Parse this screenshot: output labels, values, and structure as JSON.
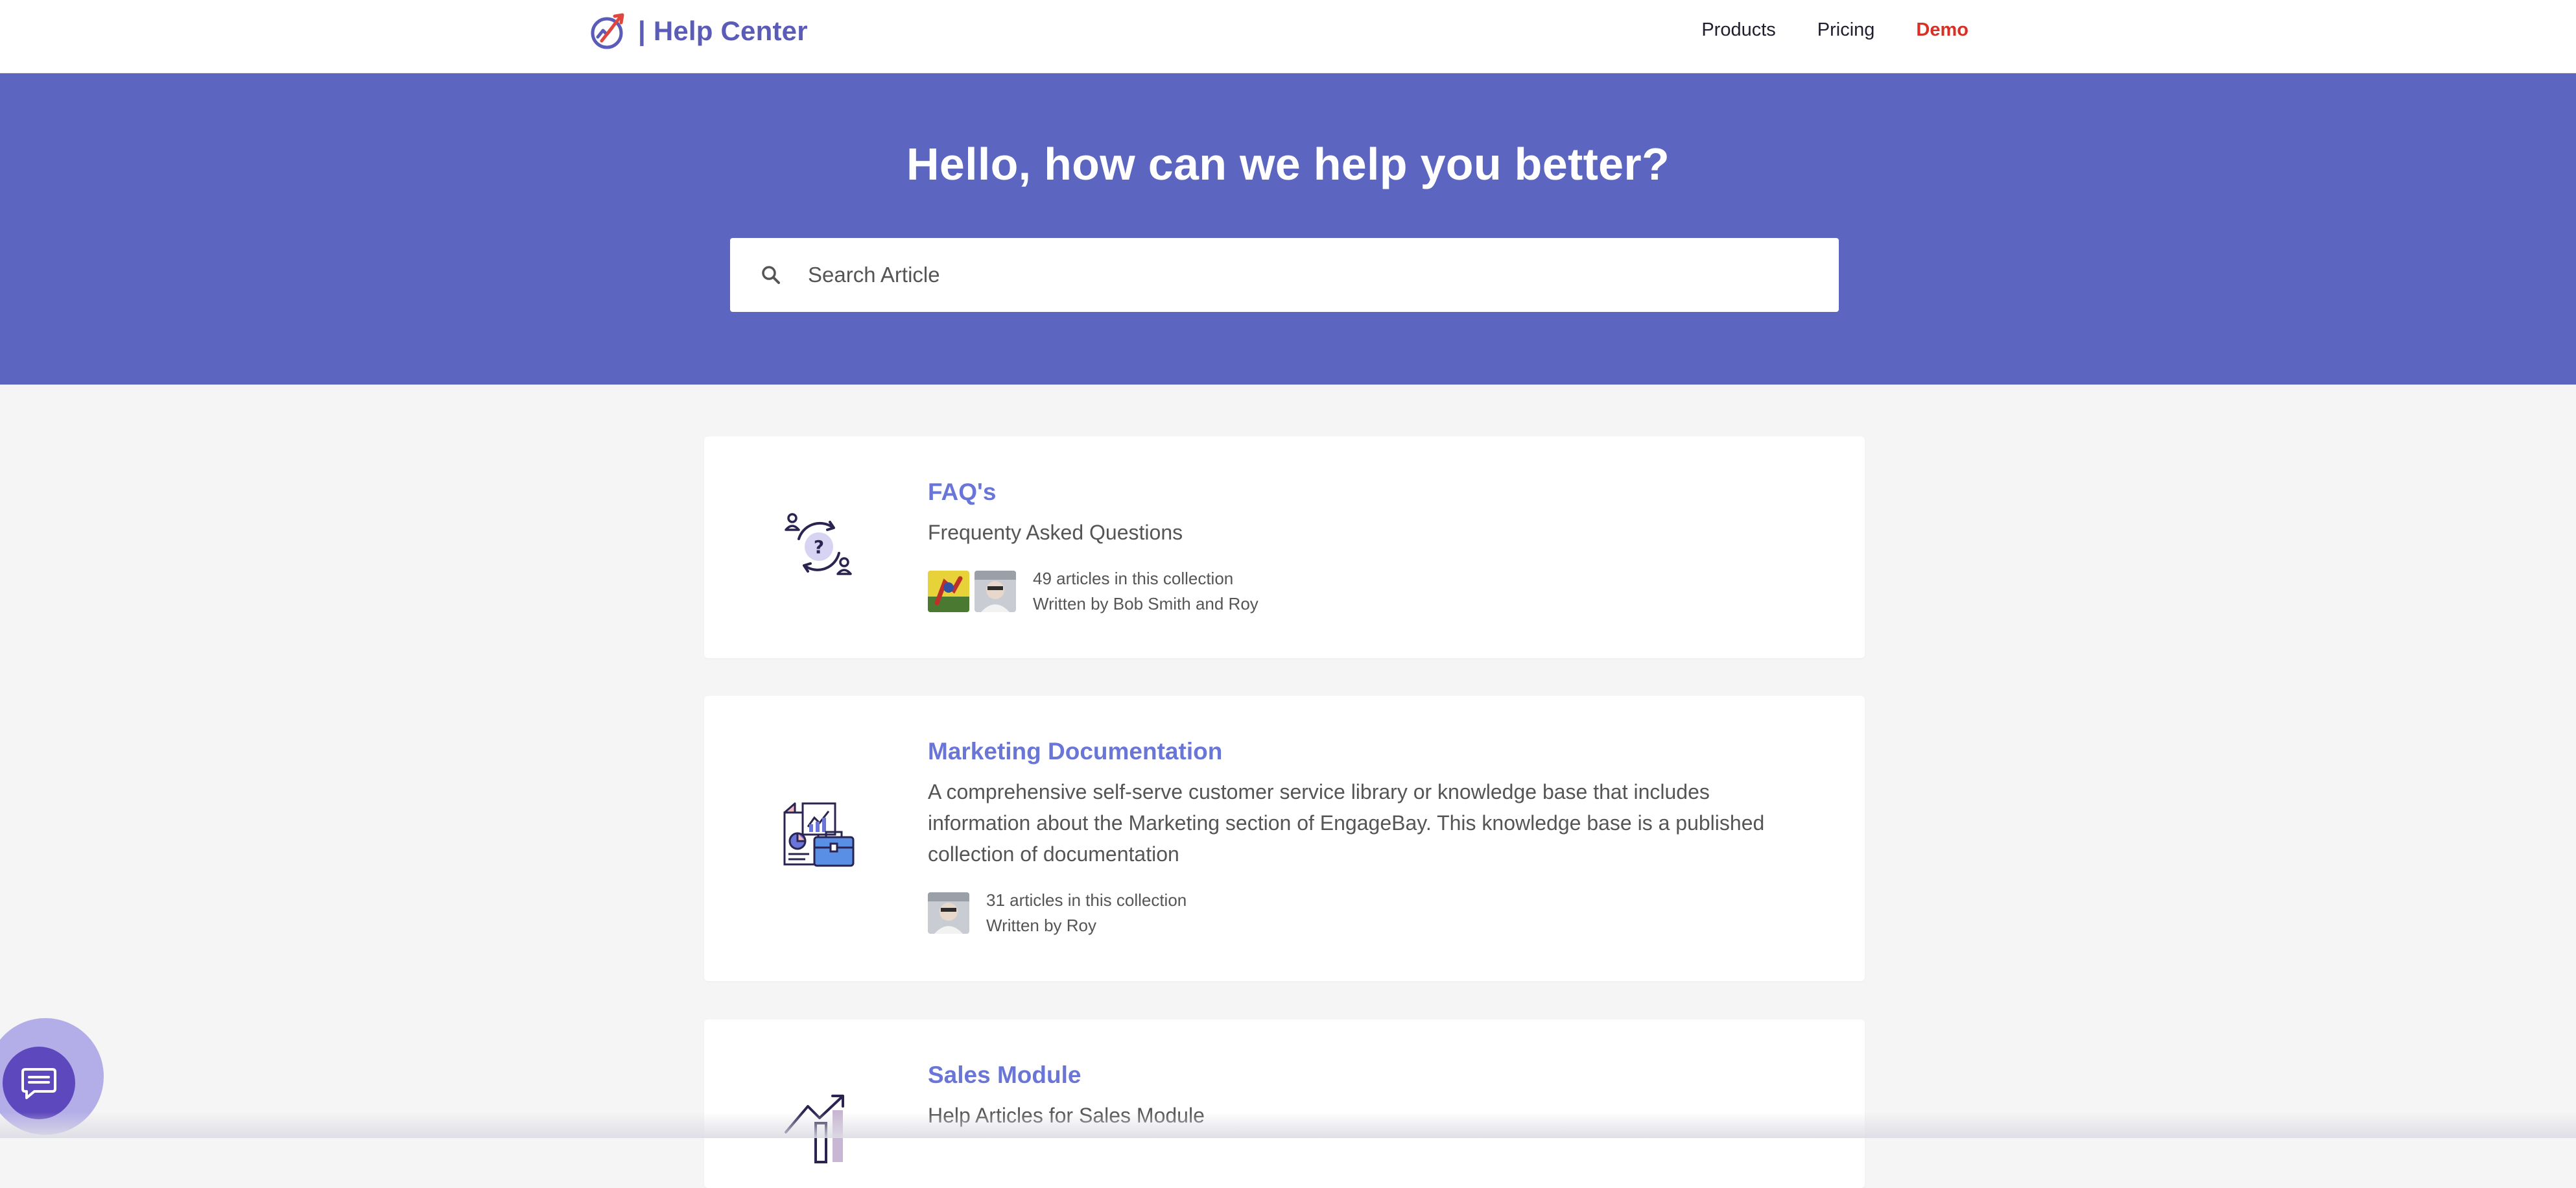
{
  "header": {
    "brand": "| Help Center",
    "nav": [
      {
        "label": "Products"
      },
      {
        "label": "Pricing"
      },
      {
        "label": "Demo"
      }
    ]
  },
  "hero": {
    "title": "Hello, how can we help you better?",
    "search_placeholder": "Search Article"
  },
  "collections": [
    {
      "title": "FAQ's",
      "description": "Frequenty Asked Questions",
      "count_text": "49 articles in this collection",
      "authors_text": "Written by Bob Smith and Roy",
      "icon": "faq-question-cycle-icon"
    },
    {
      "title": "Marketing Documentation",
      "description": "A comprehensive self-serve customer service library or knowledge base that includes information about the Marketing section of EngageBay. This knowledge base is a published collection of documentation",
      "count_text": "31 articles in this collection",
      "authors_text": "Written by Roy",
      "icon": "marketing-documents-icon"
    },
    {
      "title": "Sales Module",
      "description": "Help Articles for Sales Module",
      "icon": "sales-growth-chart-icon"
    }
  ],
  "colors": {
    "hero_bg": "#5c65c0",
    "brand": "#5b5bb8",
    "link": "#6a75d8",
    "demo": "#d93025",
    "chat": "#5e48bd"
  },
  "icons": {
    "search": "search-icon",
    "chat": "chat-bubble-icon"
  }
}
